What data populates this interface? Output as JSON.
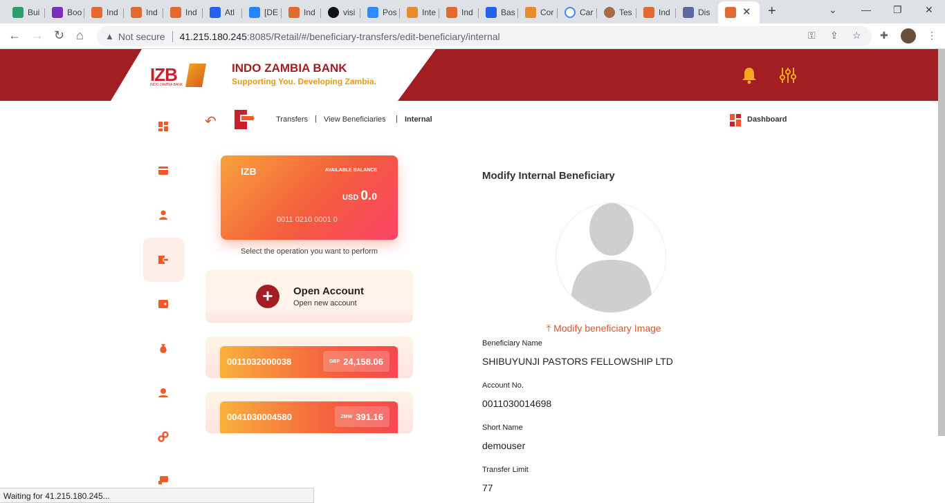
{
  "browser": {
    "tabs": [
      {
        "label": "Bui",
        "color": "#2e9e6a"
      },
      {
        "label": "Boo",
        "color": "#7b2fbf"
      },
      {
        "label": "Ind",
        "color": "#e36a2e"
      },
      {
        "label": "Ind",
        "color": "#e36a2e"
      },
      {
        "label": "Ind",
        "color": "#e36a2e"
      },
      {
        "label": "Atl",
        "color": "#2563eb"
      },
      {
        "label": "[DE",
        "color": "#2684ff"
      },
      {
        "label": "Ind",
        "color": "#e36a2e"
      },
      {
        "label": "visi",
        "color": "#111111"
      },
      {
        "label": "Pos",
        "color": "#2d8cff"
      },
      {
        "label": "Inte",
        "color": "#e88a2e"
      },
      {
        "label": "Ind",
        "color": "#e36a2e"
      },
      {
        "label": "Bas",
        "color": "#2563eb"
      },
      {
        "label": "Cor",
        "color": "#e88a2e"
      },
      {
        "label": "Car",
        "color": "#4285f4"
      },
      {
        "label": "Tes",
        "color": "#a66b4b"
      },
      {
        "label": "Ind",
        "color": "#e36a2e"
      },
      {
        "label": "Dis",
        "color": "#5a6aa0"
      }
    ],
    "security_label": "Not secure",
    "url_host": "41.215.180.245",
    "url_path": ":8085/Retail/#/beneficiary-transfers/edit-beneficiary/internal",
    "status_text": "Waiting for 41.215.180.245..."
  },
  "header": {
    "logo_text": "IZB",
    "logo_sub": "INDO ZAMBIA BANK",
    "bank_name": "INDO ZAMBIA BANK",
    "tagline": "Supporting You. Developing Zambia.",
    "brand_color": "#a31e23",
    "accent_color": "#f5a623"
  },
  "breadcrumb": {
    "items": [
      "Transfers",
      "View Beneficiaries",
      "Internal"
    ],
    "dashboard_label": "Dashboard"
  },
  "card": {
    "bank": "IZB",
    "available_label": "AVAILABLE BALANCE",
    "currency": "USD",
    "balance": "0.",
    "balance_decimal": "0",
    "account_number": "0011 0210 0001 0"
  },
  "select_operation": "Select the operation you want to perform",
  "open_account": {
    "title": "Open Account",
    "subtitle": "Open new account"
  },
  "accounts": [
    {
      "number": "0011032000038",
      "currency": "GBP",
      "amount": "24,158.06"
    },
    {
      "number": "0041030004580",
      "currency": "ZMW",
      "amount": "391.16"
    }
  ],
  "beneficiary": {
    "heading": "Modify Internal Beneficiary",
    "modify_image_label": "Modify beneficiary Image",
    "fields": [
      {
        "label": "Beneficiary Name",
        "value": "SHIBUYUNJI PASTORS FELLOWSHIP LTD"
      },
      {
        "label": "Account No.",
        "value": "0011030014698"
      },
      {
        "label": "Short Name",
        "value": "demouser"
      },
      {
        "label": "Transfer Limit",
        "value": "77"
      }
    ]
  }
}
